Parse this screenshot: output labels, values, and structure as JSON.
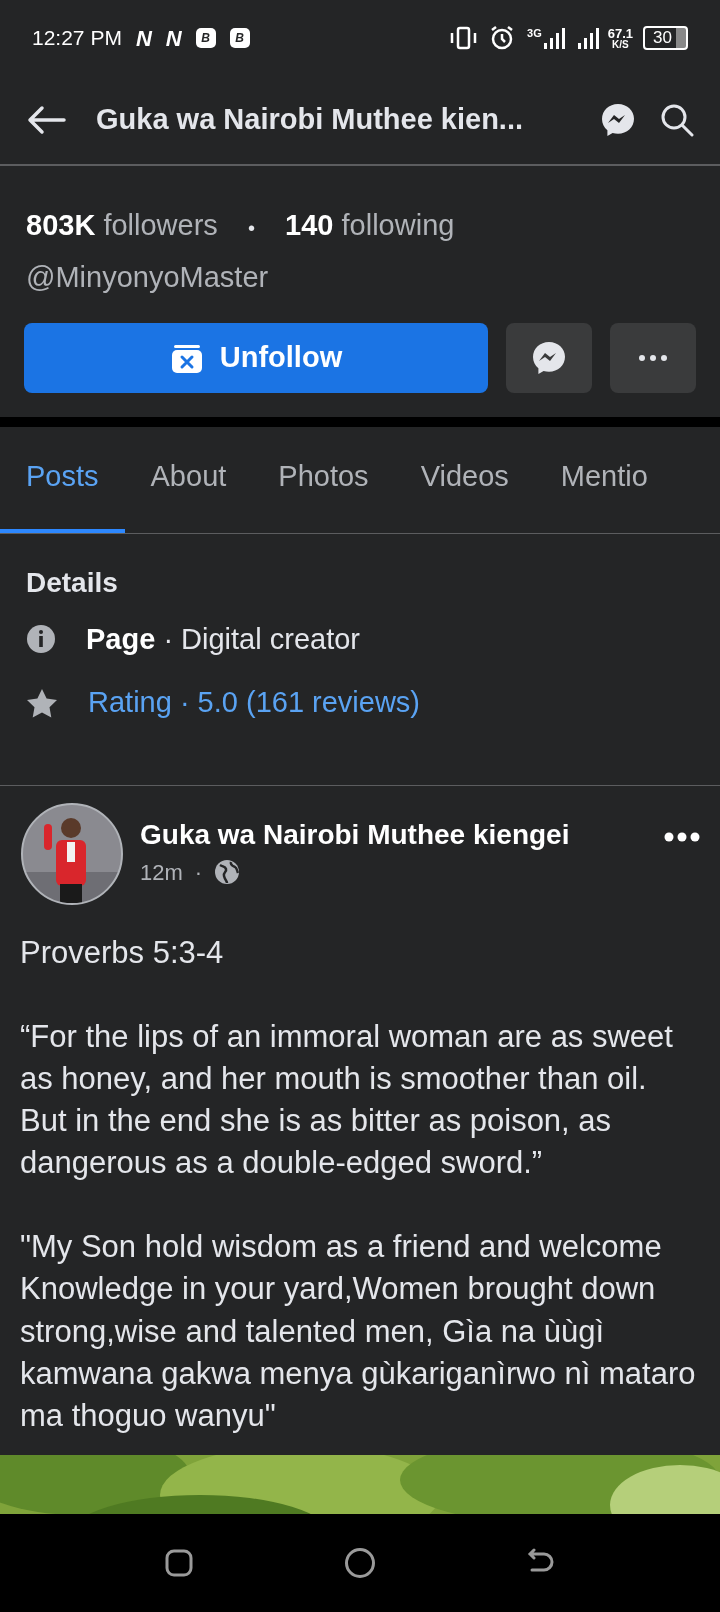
{
  "status_bar": {
    "time": "12:27 PM",
    "notifications": [
      {
        "kind": "letter",
        "text": "N"
      },
      {
        "kind": "letter",
        "text": "N"
      },
      {
        "kind": "coin",
        "text": "B"
      },
      {
        "kind": "coin",
        "text": "B"
      }
    ],
    "network": "3G",
    "speed": "67.1",
    "speed_unit": "K/S",
    "battery": "30"
  },
  "header": {
    "title": "Guka wa Nairobi Muthee kien..."
  },
  "profile": {
    "followers_count": "803K",
    "followers_label": "followers",
    "separator": "•",
    "following_count": "140",
    "following_label": "following",
    "handle": "@MinyonyoMaster",
    "primary_button": "Unfollow"
  },
  "tabs": [
    {
      "label": "Posts",
      "selected": true
    },
    {
      "label": "About",
      "selected": false
    },
    {
      "label": "Photos",
      "selected": false
    },
    {
      "label": "Videos",
      "selected": false
    },
    {
      "label": "Mentio",
      "selected": false
    }
  ],
  "details": {
    "title": "Details",
    "rows": [
      {
        "kind": "info",
        "text": "**Page** · Digital creator"
      },
      {
        "kind": "rating",
        "text": "Rating · 5.0 (161 reviews)"
      }
    ]
  },
  "post": {
    "author": "Guka wa Nairobi Muthee kiengei",
    "time": "12m",
    "separator": "·",
    "paragraphs": [
      "Proverbs 5:3-4",
      "“For the lips of an immoral woman are as sweet as honey, and her mouth is smoother than oil. But in the end she is as bitter as poison, as dangerous as a double-edged sword.”",
      "\"My Son hold wisdom as a friend and welcome Knowledge in your yard,Women brought down strong,wise and talented men, Gìa na ùùgì kamwana gakwa menya gùkariganìrwo nì mataro ma thoguo wanyu\""
    ]
  }
}
